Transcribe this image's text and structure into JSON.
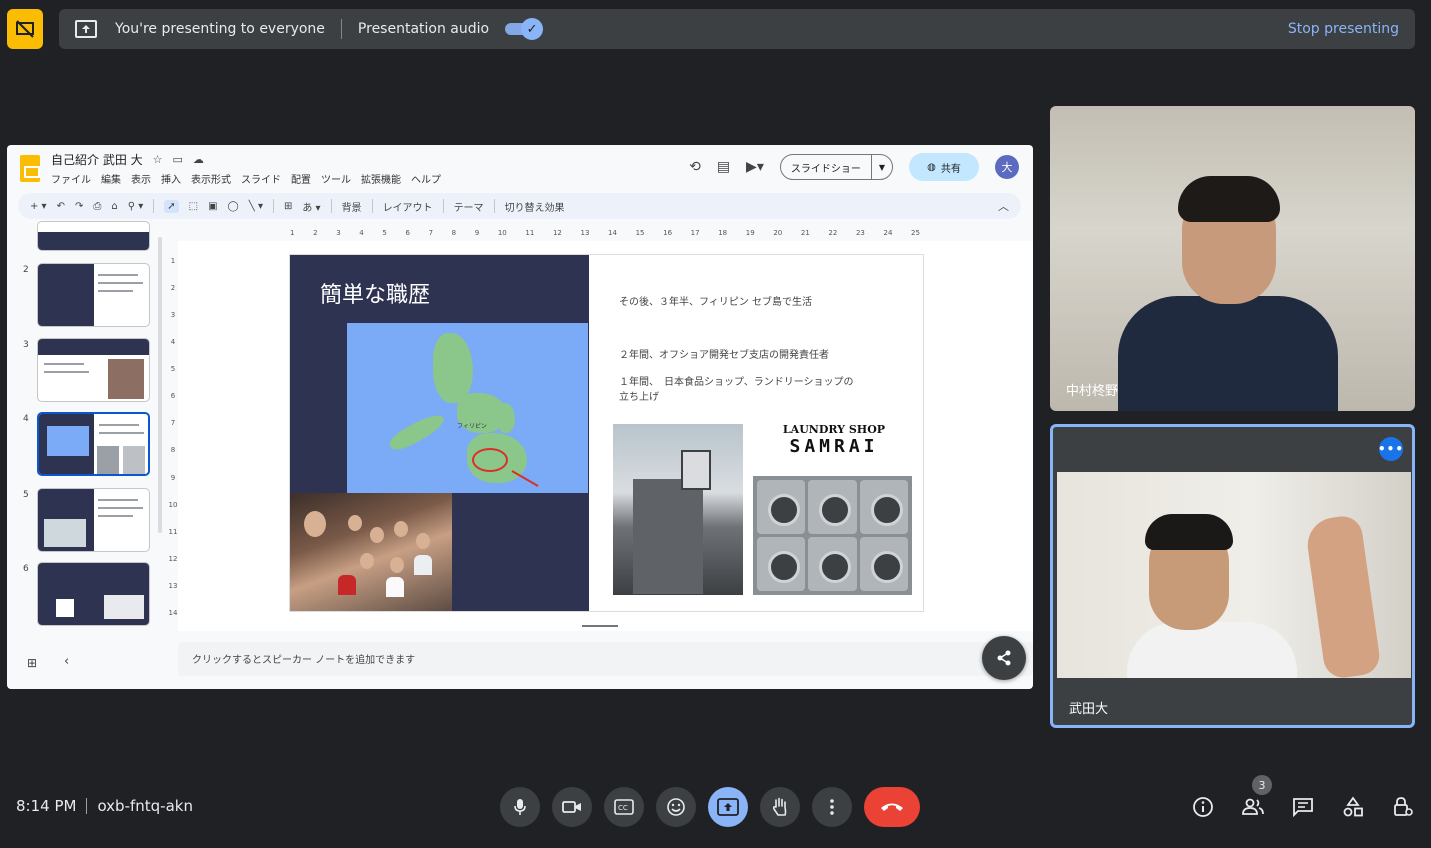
{
  "top_bar": {
    "presenting_text": "You're presenting to everyone",
    "audio_label": "Presentation audio",
    "audio_on": true,
    "stop_label": "Stop presenting"
  },
  "slides_app": {
    "doc_title": "自己紹介 武田 大",
    "menu": [
      "ファイル",
      "編集",
      "表示",
      "挿入",
      "表示形式",
      "スライド",
      "配置",
      "ツール",
      "拡張機能",
      "ヘルプ"
    ],
    "slideshow_label": "スライドショー",
    "share_label": "共有",
    "avatar_initial": "大",
    "toolbar_labels": [
      "背景",
      "レイアウト",
      "テーマ",
      "切り替え効果"
    ],
    "thumb_numbers": [
      "2",
      "3",
      "4",
      "5",
      "6"
    ],
    "selected_slide": "4",
    "ruler_h": [
      "1",
      "2",
      "3",
      "4",
      "5",
      "6",
      "7",
      "8",
      "9",
      "10",
      "11",
      "12",
      "13",
      "14",
      "15",
      "16",
      "17",
      "18",
      "19",
      "20",
      "21",
      "22",
      "23",
      "24",
      "25"
    ],
    "ruler_v": [
      "1",
      "2",
      "3",
      "4",
      "5",
      "6",
      "7",
      "8",
      "9",
      "10",
      "11",
      "12",
      "13",
      "14"
    ],
    "notes_placeholder": "クリックするとスピーカー ノートを追加できます",
    "slide": {
      "title": "簡単な職歴",
      "line1": "その後、３年半、フィリピン セブ島で生活",
      "line2": "２年間、オフショア開発セブ支店の開発責任者",
      "line3a": "１年間、　日本食品ショップ、ランドリーショップの",
      "line3b": "立ち上げ",
      "map_label": "フィリピン",
      "laundry_line1": "LAUNDRY SHOP",
      "laundry_line2": "SAMRAI"
    }
  },
  "participants": [
    {
      "name": "中村柊野"
    },
    {
      "name": "武田大",
      "active": true
    }
  ],
  "meeting": {
    "time": "8:14 PM",
    "code": "oxb-fntq-akn",
    "participant_count": "3"
  },
  "colors": {
    "accent": "#8ab4f8",
    "end_call": "#ea4335",
    "present_badge": "#fbbc04"
  }
}
